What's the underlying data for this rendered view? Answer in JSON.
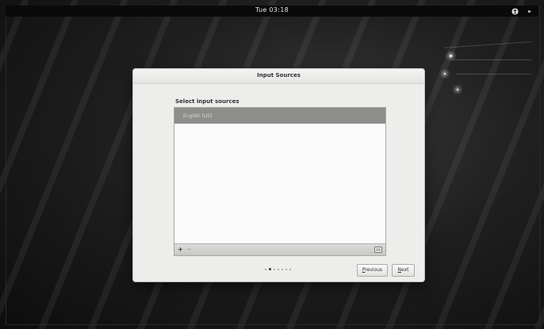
{
  "topbar": {
    "clock": "Tue 03:18",
    "icons": [
      "accessibility-icon",
      "system-menu-icon"
    ]
  },
  "dialog": {
    "title": "Input Sources",
    "section_label": "Select input sources",
    "list": {
      "items": [
        {
          "label": "English (US)",
          "selected": true
        }
      ]
    },
    "toolbar": {
      "add_label": "+",
      "remove_label": "−",
      "icons": [
        "add-icon",
        "remove-icon",
        "keyboard-icon"
      ]
    },
    "pager": {
      "total_pages": 7,
      "current_page": 2
    },
    "buttons": {
      "previous_mnemonic": "P",
      "previous_rest": "revious",
      "next_mnemonic": "N",
      "next_rest": "ext"
    }
  },
  "colors": {
    "desktop_bg": "#141414",
    "topbar_bg": "#0a0a0a",
    "dialog_bg": "#ededec",
    "selection_bg": "#8e8e8c"
  }
}
